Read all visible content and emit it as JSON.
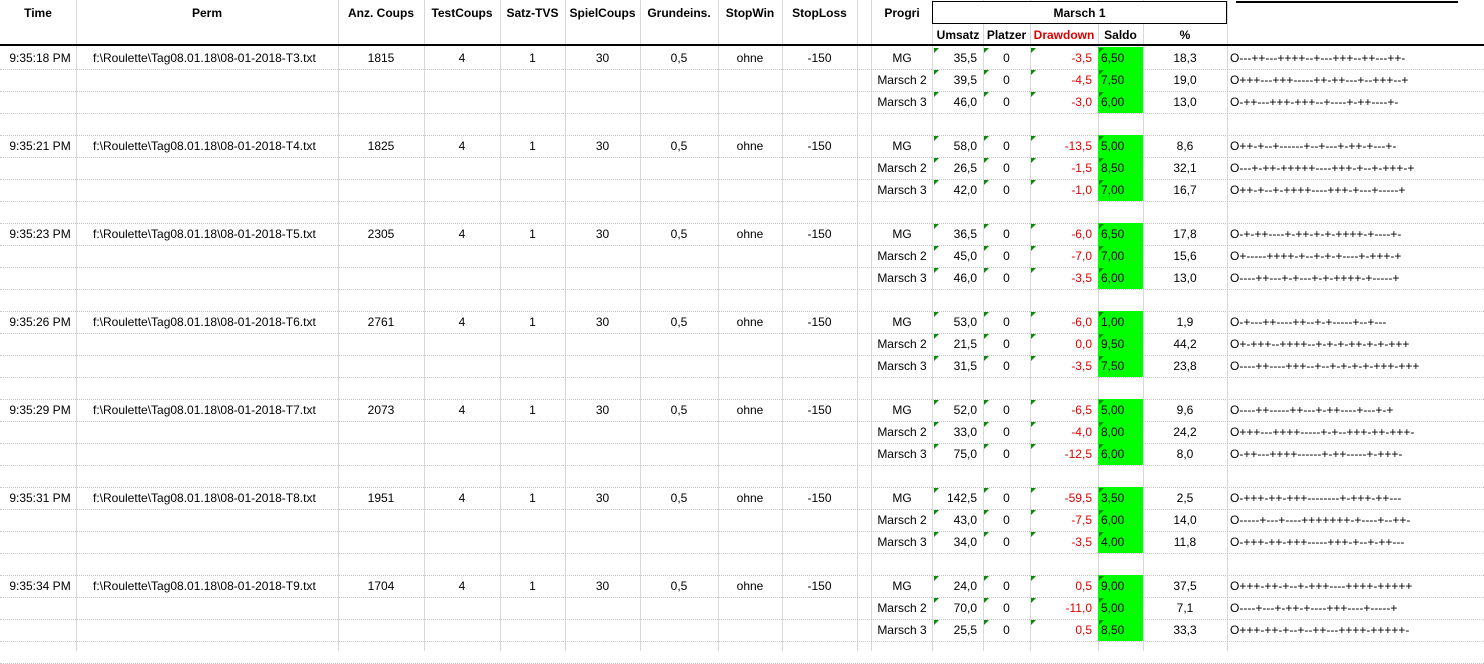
{
  "headers": {
    "time": "Time",
    "perm": "Perm",
    "anz_coups": "Anz. Coups",
    "test_coups": "TestCoups",
    "satz_tvs": "Satz-TVS",
    "spiel_coups": "SpielCoups",
    "grundeins": "Grundeins.",
    "stop_win": "StopWin",
    "stop_loss": "StopLoss",
    "progri": "Progri",
    "group": "Marsch 1",
    "umsatz": "Umsatz",
    "platzer": "Platzer",
    "drawdown": "Drawdown",
    "saldo": "Saldo",
    "percent": "%"
  },
  "colors": {
    "drawdown_red": "#e00000",
    "saldo_green": "#00ff00",
    "marker_green": "#0a8a0a"
  },
  "blocks": [
    {
      "time": "9:35:18 PM",
      "perm": "f:\\Roulette\\Tag08.01.18\\08-01-2018-T3.txt",
      "anz": "1815",
      "test": "4",
      "satz": "1",
      "spiel": "30",
      "grund": "0,5",
      "stopwin": "ohne",
      "stoploss": "-150",
      "rows": [
        {
          "progri": "MG",
          "umsatz": "35,5",
          "platzer": "0",
          "drawdown": "-3,5",
          "saldo": "6,50",
          "percent": "18,3",
          "pattern": "O---++---++++--+---+++--++---++-"
        },
        {
          "progri": "Marsch 2",
          "umsatz": "39,5",
          "platzer": "0",
          "drawdown": "-4,5",
          "saldo": "7,50",
          "percent": "19,0",
          "pattern": "O+++---+++-----++-++---+--+++--+"
        },
        {
          "progri": "Marsch 3",
          "umsatz": "46,0",
          "platzer": "0",
          "drawdown": "-3,0",
          "saldo": "6,00",
          "percent": "13,0",
          "pattern": "O-++---+++-+++--+----+-++----+-"
        }
      ]
    },
    {
      "time": "9:35:21 PM",
      "perm": "f:\\Roulette\\Tag08.01.18\\08-01-2018-T4.txt",
      "anz": "1825",
      "test": "4",
      "satz": "1",
      "spiel": "30",
      "grund": "0,5",
      "stopwin": "ohne",
      "stoploss": "-150",
      "rows": [
        {
          "progri": "MG",
          "umsatz": "58,0",
          "platzer": "0",
          "drawdown": "-13,5",
          "saldo": "5,00",
          "percent": "8,6",
          "pattern": "O++-+--+------+--+---+-++-+---+-"
        },
        {
          "progri": "Marsch 2",
          "umsatz": "26,5",
          "platzer": "0",
          "drawdown": "-1,5",
          "saldo": "8,50",
          "percent": "32,1",
          "pattern": "O---+-++-+++++----+++-+--+-+++-+"
        },
        {
          "progri": "Marsch 3",
          "umsatz": "42,0",
          "platzer": "0",
          "drawdown": "-1,0",
          "saldo": "7,00",
          "percent": "16,7",
          "pattern": "O++-+--+-++++----+++-+---+-----+"
        }
      ]
    },
    {
      "time": "9:35:23 PM",
      "perm": "f:\\Roulette\\Tag08.01.18\\08-01-2018-T5.txt",
      "anz": "2305",
      "test": "4",
      "satz": "1",
      "spiel": "30",
      "grund": "0,5",
      "stopwin": "ohne",
      "stoploss": "-150",
      "rows": [
        {
          "progri": "MG",
          "umsatz": "36,5",
          "platzer": "0",
          "drawdown": "-6,0",
          "saldo": "6,50",
          "percent": "17,8",
          "pattern": "O-+-++----+-++-+-+-++++-+----+-"
        },
        {
          "progri": "Marsch 2",
          "umsatz": "45,0",
          "platzer": "0",
          "drawdown": "-7,0",
          "saldo": "7,00",
          "percent": "15,6",
          "pattern": "O+-----++++-+--+-+-+----+-+++-+"
        },
        {
          "progri": "Marsch 3",
          "umsatz": "46,0",
          "platzer": "0",
          "drawdown": "-3,5",
          "saldo": "6,00",
          "percent": "13,0",
          "pattern": "O----++---+-+---+-+-++++-+-----+"
        }
      ]
    },
    {
      "time": "9:35:26 PM",
      "perm": "f:\\Roulette\\Tag08.01.18\\08-01-2018-T6.txt",
      "anz": "2761",
      "test": "4",
      "satz": "1",
      "spiel": "30",
      "grund": "0,5",
      "stopwin": "ohne",
      "stoploss": "-150",
      "rows": [
        {
          "progri": "MG",
          "umsatz": "53,0",
          "platzer": "0",
          "drawdown": "-6,0",
          "saldo": "1,00",
          "percent": "1,9",
          "pattern": "O-+---++----++--+-+-----+--+---"
        },
        {
          "progri": "Marsch 2",
          "umsatz": "21,5",
          "platzer": "0",
          "drawdown": "0,0",
          "saldo": "9,50",
          "percent": "44,2",
          "pattern": "O+-+++--++++--+-+-+-++-+-+-+++"
        },
        {
          "progri": "Marsch 3",
          "umsatz": "31,5",
          "platzer": "0",
          "drawdown": "-3,5",
          "saldo": "7,50",
          "percent": "23,8",
          "pattern": "O----++----+++--+--+-+-+-+-+++-+++"
        }
      ]
    },
    {
      "time": "9:35:29 PM",
      "perm": "f:\\Roulette\\Tag08.01.18\\08-01-2018-T7.txt",
      "anz": "2073",
      "test": "4",
      "satz": "1",
      "spiel": "30",
      "grund": "0,5",
      "stopwin": "ohne",
      "stoploss": "-150",
      "rows": [
        {
          "progri": "MG",
          "umsatz": "52,0",
          "platzer": "0",
          "drawdown": "-6,5",
          "saldo": "5,00",
          "percent": "9,6",
          "pattern": "O----++-----++---+-++----+---+-+"
        },
        {
          "progri": "Marsch 2",
          "umsatz": "33,0",
          "platzer": "0",
          "drawdown": "-4,0",
          "saldo": "8,00",
          "percent": "24,2",
          "pattern": "O+++---++++-----+-+--+++-++-+++-"
        },
        {
          "progri": "Marsch 3",
          "umsatz": "75,0",
          "platzer": "0",
          "drawdown": "-12,5",
          "saldo": "6,00",
          "percent": "8,0",
          "pattern": "O-++---++++------+-++-----+-+++-"
        }
      ]
    },
    {
      "time": "9:35:31 PM",
      "perm": "f:\\Roulette\\Tag08.01.18\\08-01-2018-T8.txt",
      "anz": "1951",
      "test": "4",
      "satz": "1",
      "spiel": "30",
      "grund": "0,5",
      "stopwin": "ohne",
      "stoploss": "-150",
      "rows": [
        {
          "progri": "MG",
          "umsatz": "142,5",
          "platzer": "0",
          "drawdown": "-59,5",
          "saldo": "3,50",
          "percent": "2,5",
          "pattern": "O-+++-++-+++--------+-+++-++---"
        },
        {
          "progri": "Marsch 2",
          "umsatz": "43,0",
          "platzer": "0",
          "drawdown": "-7,5",
          "saldo": "6,00",
          "percent": "14,0",
          "pattern": "O-----+---+----+++++++-+----+--++-"
        },
        {
          "progri": "Marsch 3",
          "umsatz": "34,0",
          "platzer": "0",
          "drawdown": "-3,5",
          "saldo": "4,00",
          "percent": "11,8",
          "pattern": "O-+++-++-+++-----+++-+--+-++---"
        }
      ]
    },
    {
      "time": "9:35:34 PM",
      "perm": "f:\\Roulette\\Tag08.01.18\\08-01-2018-T9.txt",
      "anz": "1704",
      "test": "4",
      "satz": "1",
      "spiel": "30",
      "grund": "0,5",
      "stopwin": "ohne",
      "stoploss": "-150",
      "rows": [
        {
          "progri": "MG",
          "umsatz": "24,0",
          "platzer": "0",
          "drawdown": "0,5",
          "saldo": "9,00",
          "percent": "37,5",
          "pattern": "O+++-++-+--+-+++----++++-+++++"
        },
        {
          "progri": "Marsch 2",
          "umsatz": "70,0",
          "platzer": "0",
          "drawdown": "-11,0",
          "saldo": "5,00",
          "percent": "7,1",
          "pattern": "O----+---+-++-+----+++----+-----+"
        },
        {
          "progri": "Marsch 3",
          "umsatz": "25,5",
          "platzer": "0",
          "drawdown": "0,5",
          "saldo": "8,50",
          "percent": "33,3",
          "pattern": "O+++-++-+--+--++---++++-+++++-"
        }
      ]
    }
  ]
}
